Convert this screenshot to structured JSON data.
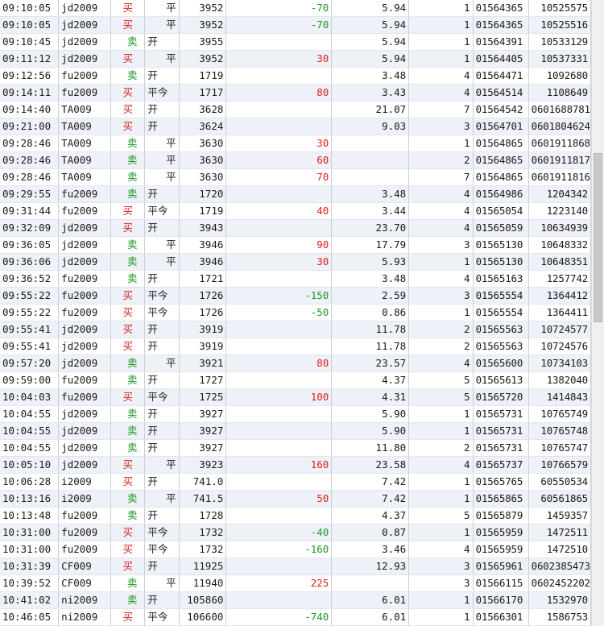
{
  "trades": [
    {
      "time": "09:10:05",
      "symbol": "jd2009",
      "side": "买",
      "action": "平",
      "price": "3952",
      "pnl": "-70",
      "fee": "5.94",
      "qty": "1",
      "order": "01564365",
      "trade": "10525575"
    },
    {
      "time": "09:10:05",
      "symbol": "jd2009",
      "side": "买",
      "action": "平",
      "price": "3952",
      "pnl": "-70",
      "fee": "5.94",
      "qty": "1",
      "order": "01564365",
      "trade": "10525516"
    },
    {
      "time": "09:10:45",
      "symbol": "jd2009",
      "side": "卖",
      "action": "开",
      "price": "3955",
      "pnl": "",
      "fee": "5.94",
      "qty": "1",
      "order": "01564391",
      "trade": "10533129"
    },
    {
      "time": "09:11:12",
      "symbol": "jd2009",
      "side": "买",
      "action": "平",
      "price": "3952",
      "pnl": "30",
      "fee": "5.94",
      "qty": "1",
      "order": "01564405",
      "trade": "10537331"
    },
    {
      "time": "09:12:56",
      "symbol": "fu2009",
      "side": "卖",
      "action": "开",
      "price": "1719",
      "pnl": "",
      "fee": "3.48",
      "qty": "4",
      "order": "01564471",
      "trade": "1092680"
    },
    {
      "time": "09:14:11",
      "symbol": "fu2009",
      "side": "买",
      "action": "平今",
      "price": "1717",
      "pnl": "80",
      "fee": "3.43",
      "qty": "4",
      "order": "01564514",
      "trade": "1108649"
    },
    {
      "time": "09:14:40",
      "symbol": "TA009",
      "side": "买",
      "action": "开",
      "price": "3628",
      "pnl": "",
      "fee": "21.07",
      "qty": "7",
      "order": "01564542",
      "trade": "0601688781"
    },
    {
      "time": "09:21:00",
      "symbol": "TA009",
      "side": "买",
      "action": "开",
      "price": "3624",
      "pnl": "",
      "fee": "9.03",
      "qty": "3",
      "order": "01564701",
      "trade": "0601804624"
    },
    {
      "time": "09:28:46",
      "symbol": "TA009",
      "side": "卖",
      "action": "平",
      "price": "3630",
      "pnl": "30",
      "fee": "",
      "qty": "1",
      "order": "01564865",
      "trade": "0601911868"
    },
    {
      "time": "09:28:46",
      "symbol": "TA009",
      "side": "卖",
      "action": "平",
      "price": "3630",
      "pnl": "60",
      "fee": "",
      "qty": "2",
      "order": "01564865",
      "trade": "0601911817"
    },
    {
      "time": "09:28:46",
      "symbol": "TA009",
      "side": "卖",
      "action": "平",
      "price": "3630",
      "pnl": "70",
      "fee": "",
      "qty": "7",
      "order": "01564865",
      "trade": "0601911816"
    },
    {
      "time": "09:29:55",
      "symbol": "fu2009",
      "side": "卖",
      "action": "开",
      "price": "1720",
      "pnl": "",
      "fee": "3.48",
      "qty": "4",
      "order": "01564986",
      "trade": "1204342"
    },
    {
      "time": "09:31:44",
      "symbol": "fu2009",
      "side": "买",
      "action": "平今",
      "price": "1719",
      "pnl": "40",
      "fee": "3.44",
      "qty": "4",
      "order": "01565054",
      "trade": "1223140"
    },
    {
      "time": "09:32:09",
      "symbol": "jd2009",
      "side": "买",
      "action": "开",
      "price": "3943",
      "pnl": "",
      "fee": "23.70",
      "qty": "4",
      "order": "01565059",
      "trade": "10634939"
    },
    {
      "time": "09:36:05",
      "symbol": "jd2009",
      "side": "卖",
      "action": "平",
      "price": "3946",
      "pnl": "90",
      "fee": "17.79",
      "qty": "3",
      "order": "01565130",
      "trade": "10648332"
    },
    {
      "time": "09:36:06",
      "symbol": "jd2009",
      "side": "卖",
      "action": "平",
      "price": "3946",
      "pnl": "30",
      "fee": "5.93",
      "qty": "1",
      "order": "01565130",
      "trade": "10648351"
    },
    {
      "time": "09:36:52",
      "symbol": "fu2009",
      "side": "卖",
      "action": "开",
      "price": "1721",
      "pnl": "",
      "fee": "3.48",
      "qty": "4",
      "order": "01565163",
      "trade": "1257742"
    },
    {
      "time": "09:55:22",
      "symbol": "fu2009",
      "side": "买",
      "action": "平今",
      "price": "1726",
      "pnl": "-150",
      "fee": "2.59",
      "qty": "3",
      "order": "01565554",
      "trade": "1364412"
    },
    {
      "time": "09:55:22",
      "symbol": "fu2009",
      "side": "买",
      "action": "平今",
      "price": "1726",
      "pnl": "-50",
      "fee": "0.86",
      "qty": "1",
      "order": "01565554",
      "trade": "1364411"
    },
    {
      "time": "09:55:41",
      "symbol": "jd2009",
      "side": "买",
      "action": "开",
      "price": "3919",
      "pnl": "",
      "fee": "11.78",
      "qty": "2",
      "order": "01565563",
      "trade": "10724577"
    },
    {
      "time": "09:55:41",
      "symbol": "jd2009",
      "side": "买",
      "action": "开",
      "price": "3919",
      "pnl": "",
      "fee": "11.78",
      "qty": "2",
      "order": "01565563",
      "trade": "10724576"
    },
    {
      "time": "09:57:20",
      "symbol": "jd2009",
      "side": "卖",
      "action": "平",
      "price": "3921",
      "pnl": "80",
      "fee": "23.57",
      "qty": "4",
      "order": "01565600",
      "trade": "10734103"
    },
    {
      "time": "09:59:00",
      "symbol": "fu2009",
      "side": "卖",
      "action": "开",
      "price": "1727",
      "pnl": "",
      "fee": "4.37",
      "qty": "5",
      "order": "01565613",
      "trade": "1382040"
    },
    {
      "time": "10:04:03",
      "symbol": "fu2009",
      "side": "买",
      "action": "平今",
      "price": "1725",
      "pnl": "100",
      "fee": "4.31",
      "qty": "5",
      "order": "01565720",
      "trade": "1414843"
    },
    {
      "time": "10:04:55",
      "symbol": "jd2009",
      "side": "卖",
      "action": "开",
      "price": "3927",
      "pnl": "",
      "fee": "5.90",
      "qty": "1",
      "order": "01565731",
      "trade": "10765749"
    },
    {
      "time": "10:04:55",
      "symbol": "jd2009",
      "side": "卖",
      "action": "开",
      "price": "3927",
      "pnl": "",
      "fee": "5.90",
      "qty": "1",
      "order": "01565731",
      "trade": "10765748"
    },
    {
      "time": "10:04:55",
      "symbol": "jd2009",
      "side": "卖",
      "action": "开",
      "price": "3927",
      "pnl": "",
      "fee": "11.80",
      "qty": "2",
      "order": "01565731",
      "trade": "10765747"
    },
    {
      "time": "10:05:10",
      "symbol": "jd2009",
      "side": "买",
      "action": "平",
      "price": "3923",
      "pnl": "160",
      "fee": "23.58",
      "qty": "4",
      "order": "01565737",
      "trade": "10766579"
    },
    {
      "time": "10:06:28",
      "symbol": "i2009",
      "side": "买",
      "action": "开",
      "price": "741.0",
      "pnl": "",
      "fee": "7.42",
      "qty": "1",
      "order": "01565765",
      "trade": "60550534"
    },
    {
      "time": "10:13:16",
      "symbol": "i2009",
      "side": "卖",
      "action": "平",
      "price": "741.5",
      "pnl": "50",
      "fee": "7.42",
      "qty": "1",
      "order": "01565865",
      "trade": "60561865"
    },
    {
      "time": "10:13:48",
      "symbol": "fu2009",
      "side": "卖",
      "action": "开",
      "price": "1728",
      "pnl": "",
      "fee": "4.37",
      "qty": "5",
      "order": "01565879",
      "trade": "1459357"
    },
    {
      "time": "10:31:00",
      "symbol": "fu2009",
      "side": "买",
      "action": "平今",
      "price": "1732",
      "pnl": "-40",
      "fee": "0.87",
      "qty": "1",
      "order": "01565959",
      "trade": "1472511"
    },
    {
      "time": "10:31:00",
      "symbol": "fu2009",
      "side": "买",
      "action": "平今",
      "price": "1732",
      "pnl": "-160",
      "fee": "3.46",
      "qty": "4",
      "order": "01565959",
      "trade": "1472510"
    },
    {
      "time": "10:31:39",
      "symbol": "CF009",
      "side": "买",
      "action": "开",
      "price": "11925",
      "pnl": "",
      "fee": "12.93",
      "qty": "3",
      "order": "01565961",
      "trade": "0602385473"
    },
    {
      "time": "10:39:52",
      "symbol": "CF009",
      "side": "卖",
      "action": "平",
      "price": "11940",
      "pnl": "225",
      "fee": "",
      "qty": "3",
      "order": "01566115",
      "trade": "0602452202"
    },
    {
      "time": "10:41:02",
      "symbol": "ni2009",
      "side": "卖",
      "action": "开",
      "price": "105860",
      "pnl": "",
      "fee": "6.01",
      "qty": "1",
      "order": "01566170",
      "trade": "1532970"
    },
    {
      "time": "10:46:05",
      "symbol": "ni2009",
      "side": "买",
      "action": "平今",
      "price": "106600",
      "pnl": "-740",
      "fee": "6.01",
      "qty": "1",
      "order": "01566301",
      "trade": "1586753"
    }
  ],
  "colors": {
    "buy": "#e0201c",
    "sell": "#1e9a2a",
    "profit": "#e0201c",
    "loss": "#1e9a2a"
  }
}
